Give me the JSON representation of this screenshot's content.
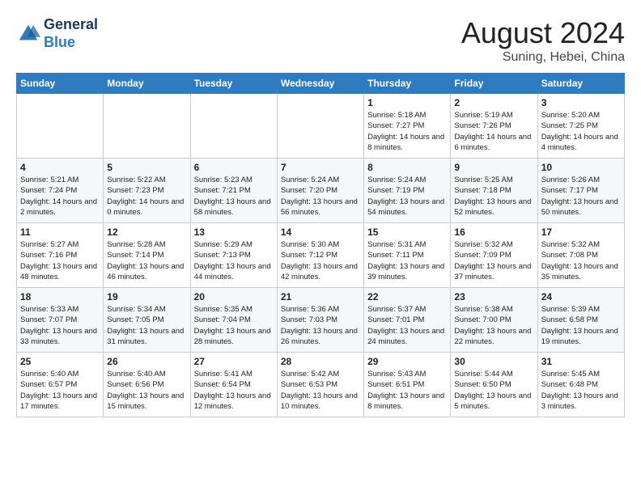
{
  "header": {
    "logo_line1": "General",
    "logo_line2": "Blue",
    "month_year": "August 2024",
    "location": "Suning, Hebei, China"
  },
  "days_of_week": [
    "Sunday",
    "Monday",
    "Tuesday",
    "Wednesday",
    "Thursday",
    "Friday",
    "Saturday"
  ],
  "weeks": [
    [
      {
        "day": "",
        "info": ""
      },
      {
        "day": "",
        "info": ""
      },
      {
        "day": "",
        "info": ""
      },
      {
        "day": "",
        "info": ""
      },
      {
        "day": "1",
        "info": "Sunrise: 5:18 AM\nSunset: 7:27 PM\nDaylight: 14 hours\nand 8 minutes."
      },
      {
        "day": "2",
        "info": "Sunrise: 5:19 AM\nSunset: 7:26 PM\nDaylight: 14 hours\nand 6 minutes."
      },
      {
        "day": "3",
        "info": "Sunrise: 5:20 AM\nSunset: 7:25 PM\nDaylight: 14 hours\nand 4 minutes."
      }
    ],
    [
      {
        "day": "4",
        "info": "Sunrise: 5:21 AM\nSunset: 7:24 PM\nDaylight: 14 hours\nand 2 minutes."
      },
      {
        "day": "5",
        "info": "Sunrise: 5:22 AM\nSunset: 7:23 PM\nDaylight: 14 hours\nand 0 minutes."
      },
      {
        "day": "6",
        "info": "Sunrise: 5:23 AM\nSunset: 7:21 PM\nDaylight: 13 hours\nand 58 minutes."
      },
      {
        "day": "7",
        "info": "Sunrise: 5:24 AM\nSunset: 7:20 PM\nDaylight: 13 hours\nand 56 minutes."
      },
      {
        "day": "8",
        "info": "Sunrise: 5:24 AM\nSunset: 7:19 PM\nDaylight: 13 hours\nand 54 minutes."
      },
      {
        "day": "9",
        "info": "Sunrise: 5:25 AM\nSunset: 7:18 PM\nDaylight: 13 hours\nand 52 minutes."
      },
      {
        "day": "10",
        "info": "Sunrise: 5:26 AM\nSunset: 7:17 PM\nDaylight: 13 hours\nand 50 minutes."
      }
    ],
    [
      {
        "day": "11",
        "info": "Sunrise: 5:27 AM\nSunset: 7:16 PM\nDaylight: 13 hours\nand 48 minutes."
      },
      {
        "day": "12",
        "info": "Sunrise: 5:28 AM\nSunset: 7:14 PM\nDaylight: 13 hours\nand 46 minutes."
      },
      {
        "day": "13",
        "info": "Sunrise: 5:29 AM\nSunset: 7:13 PM\nDaylight: 13 hours\nand 44 minutes."
      },
      {
        "day": "14",
        "info": "Sunrise: 5:30 AM\nSunset: 7:12 PM\nDaylight: 13 hours\nand 42 minutes."
      },
      {
        "day": "15",
        "info": "Sunrise: 5:31 AM\nSunset: 7:11 PM\nDaylight: 13 hours\nand 39 minutes."
      },
      {
        "day": "16",
        "info": "Sunrise: 5:32 AM\nSunset: 7:09 PM\nDaylight: 13 hours\nand 37 minutes."
      },
      {
        "day": "17",
        "info": "Sunrise: 5:32 AM\nSunset: 7:08 PM\nDaylight: 13 hours\nand 35 minutes."
      }
    ],
    [
      {
        "day": "18",
        "info": "Sunrise: 5:33 AM\nSunset: 7:07 PM\nDaylight: 13 hours\nand 33 minutes."
      },
      {
        "day": "19",
        "info": "Sunrise: 5:34 AM\nSunset: 7:05 PM\nDaylight: 13 hours\nand 31 minutes."
      },
      {
        "day": "20",
        "info": "Sunrise: 5:35 AM\nSunset: 7:04 PM\nDaylight: 13 hours\nand 28 minutes."
      },
      {
        "day": "21",
        "info": "Sunrise: 5:36 AM\nSunset: 7:03 PM\nDaylight: 13 hours\nand 26 minutes."
      },
      {
        "day": "22",
        "info": "Sunrise: 5:37 AM\nSunset: 7:01 PM\nDaylight: 13 hours\nand 24 minutes."
      },
      {
        "day": "23",
        "info": "Sunrise: 5:38 AM\nSunset: 7:00 PM\nDaylight: 13 hours\nand 22 minutes."
      },
      {
        "day": "24",
        "info": "Sunrise: 5:39 AM\nSunset: 6:58 PM\nDaylight: 13 hours\nand 19 minutes."
      }
    ],
    [
      {
        "day": "25",
        "info": "Sunrise: 5:40 AM\nSunset: 6:57 PM\nDaylight: 13 hours\nand 17 minutes."
      },
      {
        "day": "26",
        "info": "Sunrise: 5:40 AM\nSunset: 6:56 PM\nDaylight: 13 hours\nand 15 minutes."
      },
      {
        "day": "27",
        "info": "Sunrise: 5:41 AM\nSunset: 6:54 PM\nDaylight: 13 hours\nand 12 minutes."
      },
      {
        "day": "28",
        "info": "Sunrise: 5:42 AM\nSunset: 6:53 PM\nDaylight: 13 hours\nand 10 minutes."
      },
      {
        "day": "29",
        "info": "Sunrise: 5:43 AM\nSunset: 6:51 PM\nDaylight: 13 hours\nand 8 minutes."
      },
      {
        "day": "30",
        "info": "Sunrise: 5:44 AM\nSunset: 6:50 PM\nDaylight: 13 hours\nand 5 minutes."
      },
      {
        "day": "31",
        "info": "Sunrise: 5:45 AM\nSunset: 6:48 PM\nDaylight: 13 hours\nand 3 minutes."
      }
    ]
  ]
}
